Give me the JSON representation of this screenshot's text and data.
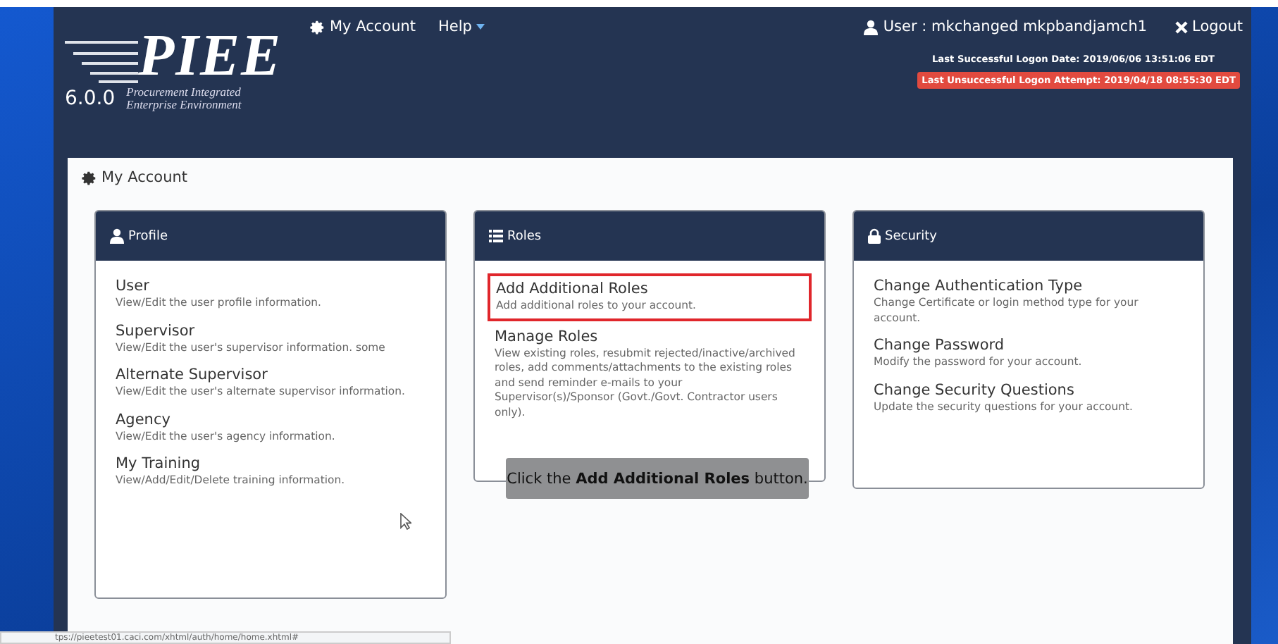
{
  "header": {
    "logo": {
      "title": "PIEE",
      "subtitle_lines": [
        "Procurement Integrated",
        "Enterprise Environment"
      ],
      "version": "6.0.0"
    },
    "nav": [
      {
        "label": "My Account"
      },
      {
        "label": "Help"
      }
    ],
    "user": "User : mkchanged mkpbandjamch1",
    "logout": "Logout",
    "last_success": "Last Successful Logon Date: 2019/06/06 13:51:06 EDT",
    "last_fail": "Last Unsuccessful Logon Attempt: 2019/04/18 08:55:30 EDT"
  },
  "page_title": "My Account",
  "cards": [
    {
      "title": "Profile",
      "items": [
        {
          "title": "User",
          "desc": "View/Edit the user profile information.",
          "highlighted": false
        },
        {
          "title": "Supervisor",
          "desc": "View/Edit the user's supervisor information. some",
          "highlighted": false
        },
        {
          "title": "Alternate Supervisor",
          "desc": "View/Edit the user's alternate supervisor information.",
          "highlighted": false
        },
        {
          "title": "Agency",
          "desc": "View/Edit the user's agency information.",
          "highlighted": false
        },
        {
          "title": "My Training",
          "desc": "View/Add/Edit/Delete training information.",
          "highlighted": false
        }
      ]
    },
    {
      "title": "Roles",
      "items": [
        {
          "title": "Add Additional Roles",
          "desc": "Add additional roles to your account.",
          "highlighted": true
        },
        {
          "title": "Manage Roles",
          "desc": "View existing roles, resubmit rejected/inactive/archived roles, add comments/attachments to the existing roles and send reminder e-mails to your Supervisor(s)/Sponsor (Govt./Govt. Contractor users only).",
          "highlighted": false
        }
      ],
      "tooltip": "Click the **Add Additional Roles** button."
    },
    {
      "title": "Security",
      "items": [
        {
          "title": "Change Authentication Type",
          "desc": "Change Certificate or login method type for your account.",
          "highlighted": false
        },
        {
          "title": "Change Password",
          "desc": "Modify the password for your account.",
          "highlighted": false
        },
        {
          "title": "Change Security Questions",
          "desc": "Update the security questions for your account.",
          "highlighted": false
        }
      ]
    }
  ],
  "status_url": "tps://pieetest01.caci.com/xhtml/auth/home/home.xhtml#"
}
